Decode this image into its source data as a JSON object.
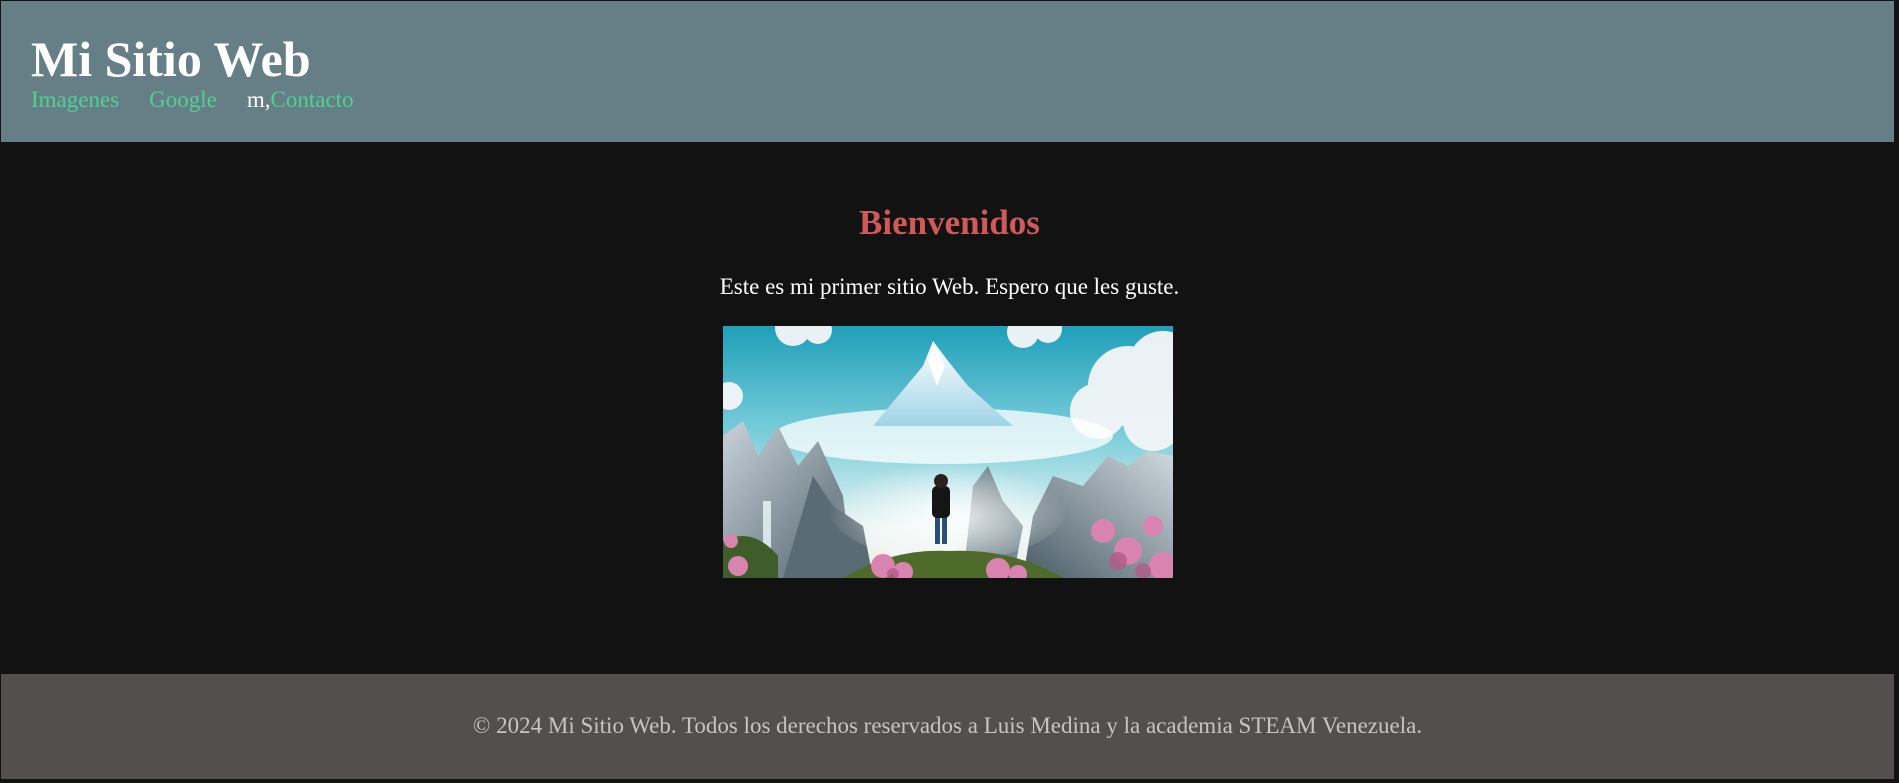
{
  "header": {
    "title": "Mi Sitio Web",
    "nav": {
      "images_label": "Imagenes",
      "google_label": "Google",
      "stray_text": "m,",
      "contact_label": "Contacto"
    }
  },
  "main": {
    "heading": "Bienvenidos",
    "intro": "Este es mi primer sitio Web. Espero que les guste."
  },
  "footer": {
    "copyright": "© 2024 Mi Sitio Web. Todos los derechos reservados a Luis Medina y la academia STEAM Venezuela."
  },
  "colors": {
    "page_background": "#121212",
    "header_background": "#667f87",
    "link": "#4fd28f",
    "heading": "#d05a59",
    "footer_background": "#524f4e",
    "footer_text": "#c9c3c2"
  }
}
